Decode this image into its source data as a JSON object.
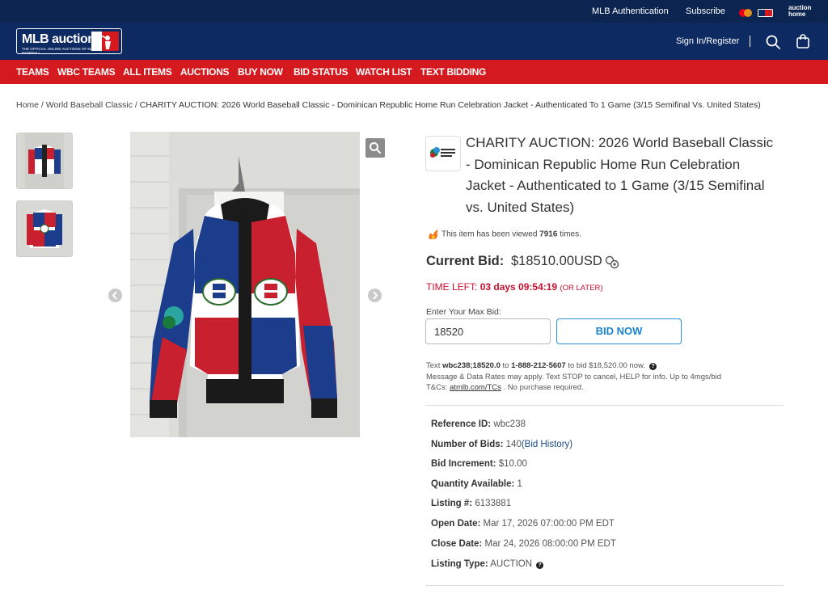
{
  "utility_bar": {
    "links": [
      "MLB Authentication",
      "Subscribe"
    ],
    "icons": [
      "mastercard-icon",
      "mlb-logo-icon"
    ],
    "auction_home_logo": "auction home"
  },
  "header": {
    "logo_text": "MLB auction",
    "logo_subtext": "THE OFFICIAL ONLINE AUCTIONS OF MAJOR LEAGUE BASEBALL",
    "signin_label": "Sign In/Register"
  },
  "nav": {
    "items": [
      "TEAMS",
      "WBC TEAMS",
      "ALL ITEMS",
      "AUCTIONS",
      "BUY NOW",
      "BID STATUS",
      "WATCH LIST",
      "TEXT BIDDING"
    ]
  },
  "breadcrumb": {
    "home": "Home",
    "category": "World Baseball Classic",
    "current": "CHARITY AUCTION: 2026 World Baseball Classic - Dominican Republic Home Run Celebration Jacket - Authenticated To 1 Game (3/15 Semifinal Vs. United States)"
  },
  "item": {
    "title": "CHARITY AUCTION: 2026 World Baseball Classic - Dominican Republic Home Run Celebration Jacket - Authenticated to 1 Game (3/15 Semifinal vs. United States)",
    "views_prefix": "This item has been viewed ",
    "views_count": "7916",
    "views_suffix": " times.",
    "current_bid_label": "Current Bid:",
    "current_bid_value": "$18510.00USD",
    "time_left_label": "TIME LEFT: ",
    "time_left_value": "03 days 09:54:19",
    "time_left_note": "(OR LATER)",
    "max_bid_label": "Enter Your Max Bid:",
    "max_bid_value": "18520",
    "bid_button": "BID NOW"
  },
  "text_bidding": {
    "line1_pre": "Text ",
    "code": "wbc238;18520.0",
    "line1_mid": " to ",
    "phone": "1-888-212-5607",
    "line1_post": " to bid $18,520.00 now.",
    "line2": "Message & Data Rates may apply. Text STOP to cancel, HELP for info. Up to 4mgs/bid",
    "line3_pre": "T&Cs: ",
    "tc_link": "atmlb.com/TCs",
    "line3_post": " . No purchase required."
  },
  "details": {
    "reference_id_label": "Reference ID:",
    "reference_id": "wbc238",
    "num_bids_label": "Number of Bids:",
    "num_bids": "140",
    "bid_history": "(Bid History)",
    "bid_increment_label": "Bid Increment:",
    "bid_increment": "$10.00",
    "quantity_label": "Quantity Available:",
    "quantity": "1",
    "listing_label": "Listing #:",
    "listing": "6133881",
    "open_date_label": "Open Date:",
    "open_date": "Mar 17, 2026 07:00:00 PM EDT",
    "close_date_label": "Close Date:",
    "close_date": "Mar 24, 2026 08:00:00 PM EDT",
    "listing_type_label": "Listing Type:",
    "listing_type": "AUCTION"
  },
  "colors": {
    "utility_bg": "#0b2550",
    "header_bg": "#0d2a63",
    "nav_red": "#d41a1f",
    "time_red": "#c8102e",
    "bid_blue": "#1a82d0"
  }
}
